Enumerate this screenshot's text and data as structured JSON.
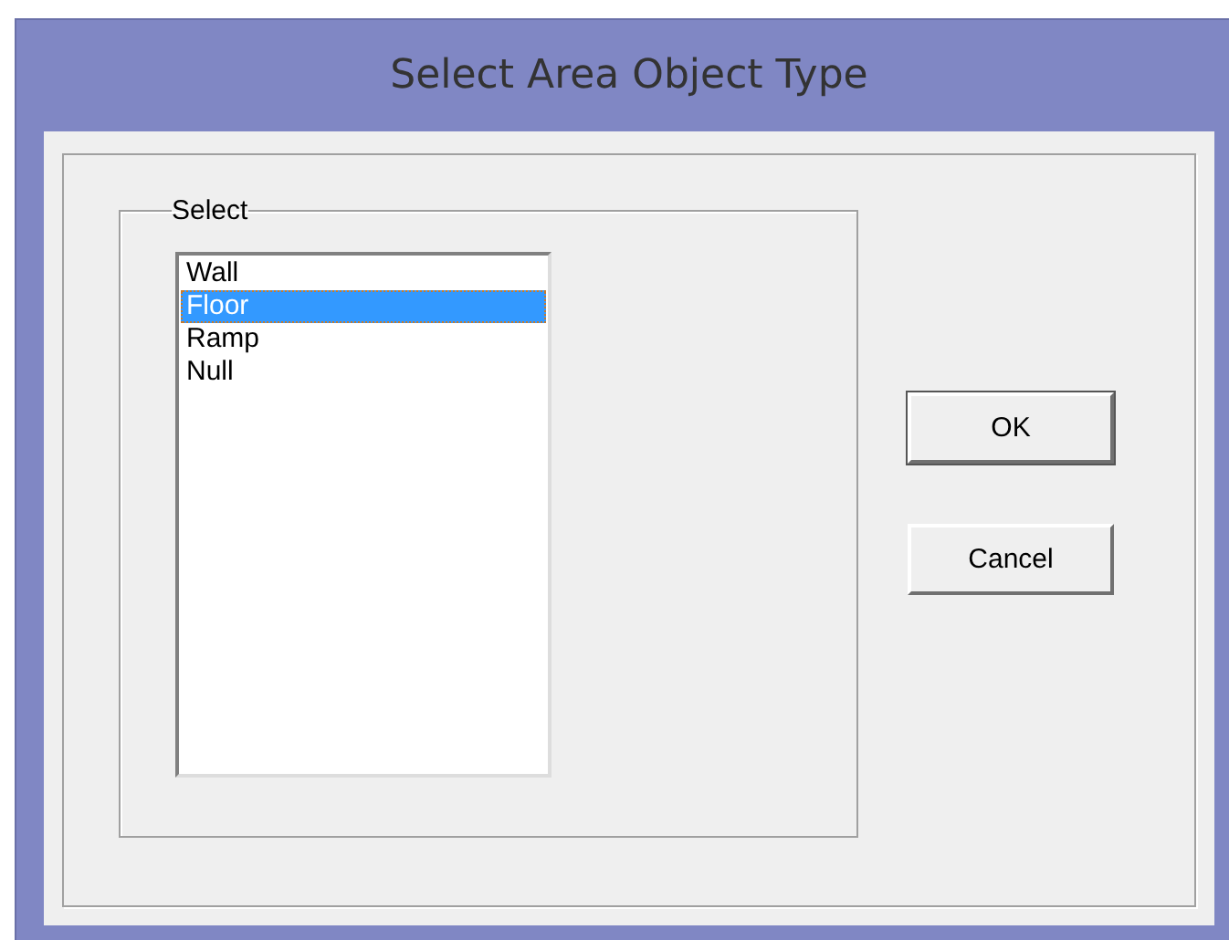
{
  "window": {
    "title": "Select Area Object Type"
  },
  "group": {
    "label": "Select"
  },
  "list_items": [
    {
      "label": "Wall",
      "selected": false
    },
    {
      "label": "Floor",
      "selected": true
    },
    {
      "label": "Ramp",
      "selected": false
    },
    {
      "label": "Null",
      "selected": false
    }
  ],
  "buttons": [
    "OK",
    "Cancel"
  ]
}
